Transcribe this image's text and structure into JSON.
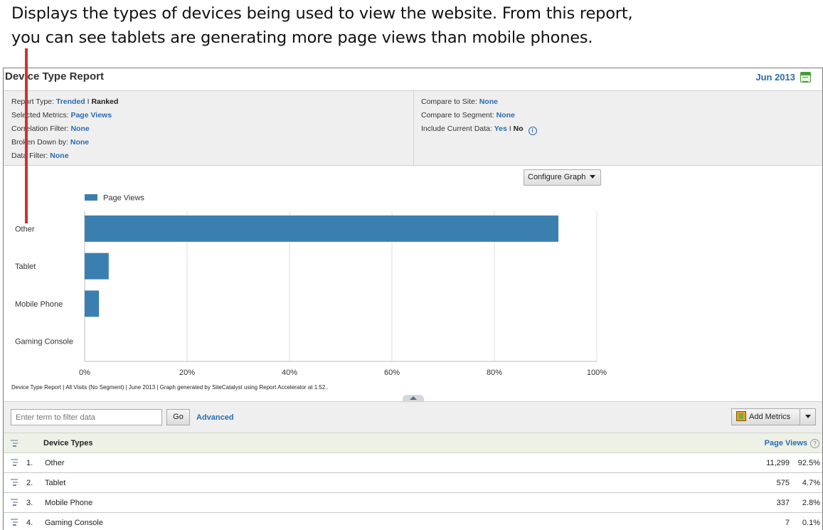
{
  "caption": {
    "line1": "Displays the types of devices being used to view the website. From this report,",
    "line2": "you can see tablets are generating more page views than mobile phones."
  },
  "header": {
    "title": "Device Type Report",
    "date": "Jun 2013"
  },
  "settings": {
    "report_type_label": "Report Type:",
    "report_type_trended": "Trended",
    "report_type_sep": " I ",
    "report_type_ranked": "Ranked",
    "metrics_label": "Selected Metrics:",
    "metrics_value": "Page Views",
    "correlation_label": "Correlation Filter:",
    "correlation_value": "None",
    "broken_label": "Broken Down by:",
    "broken_value": "None",
    "data_filter_label": "Data Filter:",
    "data_filter_value": "None",
    "compare_site_label": "Compare to Site:",
    "compare_site_value": "None",
    "compare_segment_label": "Compare to Segment:",
    "compare_segment_value": "None",
    "include_label": "Include Current Data:",
    "include_yes": "Yes",
    "include_sep": " I ",
    "include_no": "No",
    "info_glyph": "i"
  },
  "configure_graph_label": "Configure Graph",
  "chart_data": {
    "type": "bar",
    "orientation": "horizontal",
    "categories": [
      "Other",
      "Tablet",
      "Mobile Phone",
      "Gaming Console"
    ],
    "series": [
      {
        "name": "Page Views",
        "values": [
          92.5,
          4.7,
          2.8,
          0.1
        ],
        "color": "#3b7fb0"
      }
    ],
    "xlim": [
      0,
      100
    ],
    "xticks": [
      0,
      20,
      40,
      60,
      80,
      100
    ],
    "xtick_labels": [
      "0%",
      "20%",
      "40%",
      "60%",
      "80%",
      "100%"
    ],
    "grid": true,
    "legend": "top-left"
  },
  "footnote": "Device Type Report | All Visits (No Segment) | June 2013 | Graph generated by SiteCatalyst using Report Accelerator at  1:52..",
  "filter": {
    "placeholder": "Enter term to filter data",
    "go_label": "Go",
    "advanced_label": "Advanced",
    "add_metrics_label": "Add Metrics"
  },
  "table": {
    "col_name": "Device Types",
    "col_metric": "Page Views",
    "help_glyph": "?",
    "rows": [
      {
        "rank": "1.",
        "name": "Other",
        "value": "11,299",
        "pct": "92.5%"
      },
      {
        "rank": "2.",
        "name": "Tablet",
        "value": "575",
        "pct": "4.7%"
      },
      {
        "rank": "3.",
        "name": "Mobile Phone",
        "value": "337",
        "pct": "2.8%"
      },
      {
        "rank": "4.",
        "name": "Gaming Console",
        "value": "7",
        "pct": "0.1%"
      }
    ]
  }
}
